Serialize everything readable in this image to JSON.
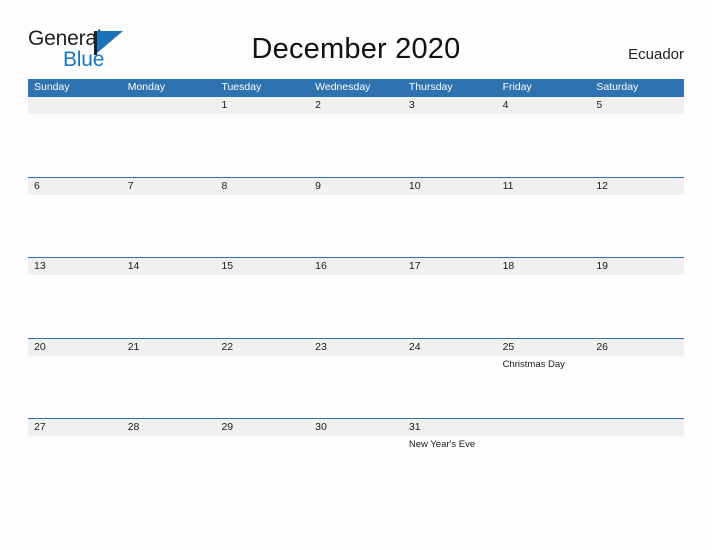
{
  "logo": {
    "word_top": "General",
    "word_bottom": "Blue",
    "flag_icon": "blue-triangle-flag-icon",
    "brand_blue": "#1878c4",
    "brand_dark": "#231f20"
  },
  "header": {
    "title": "December 2020",
    "country": "Ecuador"
  },
  "theme": {
    "header_blue": "#2e72b0",
    "band_gray": "#f0f0f0",
    "page_background": "#fdfdfd",
    "text": "#1a1a1a"
  },
  "calendar": {
    "month": "December",
    "year": "2020",
    "weekday_headers": [
      "Sunday",
      "Monday",
      "Tuesday",
      "Wednesday",
      "Thursday",
      "Friday",
      "Saturday"
    ],
    "weeks": [
      {
        "days": [
          {
            "num": "",
            "event": ""
          },
          {
            "num": "",
            "event": ""
          },
          {
            "num": "1",
            "event": ""
          },
          {
            "num": "2",
            "event": ""
          },
          {
            "num": "3",
            "event": ""
          },
          {
            "num": "4",
            "event": ""
          },
          {
            "num": "5",
            "event": ""
          }
        ]
      },
      {
        "days": [
          {
            "num": "6",
            "event": ""
          },
          {
            "num": "7",
            "event": ""
          },
          {
            "num": "8",
            "event": ""
          },
          {
            "num": "9",
            "event": ""
          },
          {
            "num": "10",
            "event": ""
          },
          {
            "num": "11",
            "event": ""
          },
          {
            "num": "12",
            "event": ""
          }
        ]
      },
      {
        "days": [
          {
            "num": "13",
            "event": ""
          },
          {
            "num": "14",
            "event": ""
          },
          {
            "num": "15",
            "event": ""
          },
          {
            "num": "16",
            "event": ""
          },
          {
            "num": "17",
            "event": ""
          },
          {
            "num": "18",
            "event": ""
          },
          {
            "num": "19",
            "event": ""
          }
        ]
      },
      {
        "days": [
          {
            "num": "20",
            "event": ""
          },
          {
            "num": "21",
            "event": ""
          },
          {
            "num": "22",
            "event": ""
          },
          {
            "num": "23",
            "event": ""
          },
          {
            "num": "24",
            "event": ""
          },
          {
            "num": "25",
            "event": "Christmas Day"
          },
          {
            "num": "26",
            "event": ""
          }
        ]
      },
      {
        "days": [
          {
            "num": "27",
            "event": ""
          },
          {
            "num": "28",
            "event": ""
          },
          {
            "num": "29",
            "event": ""
          },
          {
            "num": "30",
            "event": ""
          },
          {
            "num": "31",
            "event": "New Year's Eve"
          },
          {
            "num": "",
            "event": ""
          },
          {
            "num": "",
            "event": ""
          }
        ]
      }
    ]
  }
}
